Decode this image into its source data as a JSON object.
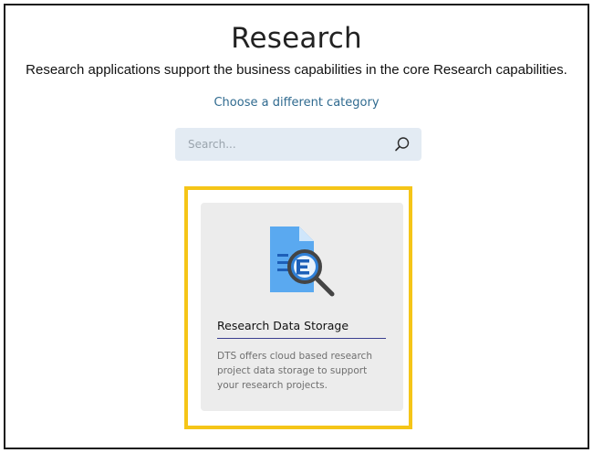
{
  "page": {
    "title": "Research",
    "subtitle": "Research applications support the business capabilities in the core Research capabilities.",
    "change_category_label": "Choose a different category"
  },
  "search": {
    "placeholder": "Search...",
    "value": "",
    "icon": "search-icon"
  },
  "cards": [
    {
      "title": "Research Data Storage",
      "description": "DTS offers cloud based research project data storage to support your research projects.",
      "icon": "document-search-icon",
      "highlighted": true
    }
  ],
  "colors": {
    "link": "#2f6a8f",
    "search_background": "#e3ebf3",
    "card_background": "#ececec",
    "highlight_border": "#f5c518",
    "card_rule": "#3a3f8f"
  }
}
